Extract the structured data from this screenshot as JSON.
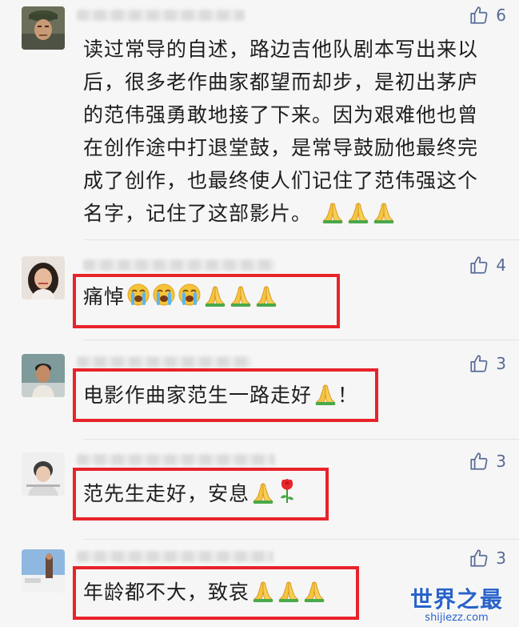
{
  "comments": [
    {
      "likes": "6",
      "text_lines": [
        "读过常导的自述，路边吉他队剧本写出来以",
        "后，很多老作曲家都望而却步，是初出茅庐",
        "的范伟强勇敢地接了下来。因为艰难他也曾",
        "在创作途中打退堂鼓，是常导鼓励他最终完",
        "成了创作，也最终使人们记住了范伟强这个",
        "名字，记住了这部影片。"
      ],
      "emojis": [
        "folded-hands",
        "folded-hands",
        "folded-hands"
      ]
    },
    {
      "likes": "4",
      "text": "痛悼",
      "emojis": [
        "loudly-crying-face",
        "loudly-crying-face",
        "loudly-crying-face",
        "folded-hands",
        "folded-hands",
        "folded-hands"
      ]
    },
    {
      "likes": "3",
      "text": "电影作曲家范生一路走好",
      "text_after": "！",
      "emojis": [
        "folded-hands"
      ]
    },
    {
      "likes": "3",
      "text": "范先生走好，安息",
      "emojis": [
        "folded-hands",
        "rose"
      ]
    },
    {
      "likes": "3",
      "text": "年龄都不大，致哀",
      "emojis": [
        "folded-hands",
        "folded-hands",
        "folded-hands"
      ]
    }
  ],
  "colors": {
    "background": "#f6f6f6",
    "like_blue": "#576b95",
    "highlight_red": "#e8232a",
    "watermark_blue": "#2a63c8"
  },
  "icons": {
    "like": "thumbs-up-icon"
  },
  "watermark": {
    "title": "世界之最",
    "url": "shijiezz.com"
  }
}
